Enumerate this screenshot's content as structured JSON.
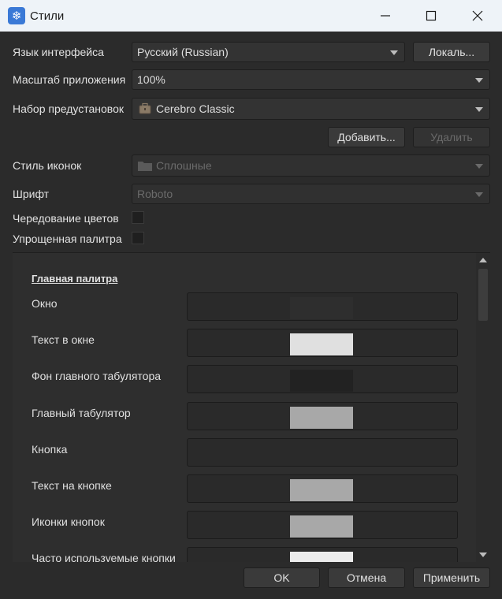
{
  "window": {
    "title": "Стили"
  },
  "form": {
    "language_label": "Язык интерфейса",
    "language_value": "Русский (Russian)",
    "locale_button": "Локаль...",
    "scale_label": "Масштаб приложения",
    "scale_value": "100%",
    "preset_label": "Набор предустановок",
    "preset_value": "Cerebro Classic",
    "add_button": "Добавить...",
    "delete_button": "Удалить",
    "icon_style_label": "Стиль иконок",
    "icon_style_value": "Сплошные",
    "font_label": "Шрифт",
    "font_value": "Roboto",
    "color_alternation_label": "Чередование цветов",
    "simplified_palette_label": "Упрощенная палитра"
  },
  "palette": {
    "title": "Главная палитра",
    "rows": [
      {
        "label": "Окно",
        "color": "#2e2e2e"
      },
      {
        "label": "Текст в окне",
        "color": "#e0e0e0"
      },
      {
        "label": "Фон главного табулятора",
        "color": "#222222"
      },
      {
        "label": "Главный табулятор",
        "color": "#a8a8a8"
      },
      {
        "label": "Кнопка",
        "color": "#2a2a2a"
      },
      {
        "label": "Текст на кнопке",
        "color": "#a8a8a8"
      },
      {
        "label": "Иконки кнопок",
        "color": "#a8a8a8"
      },
      {
        "label": "Часто используемые кнопки",
        "color": "#ececec"
      }
    ]
  },
  "footer": {
    "ok_button": "OK",
    "cancel_button": "Отмена",
    "apply_button": "Применить"
  }
}
